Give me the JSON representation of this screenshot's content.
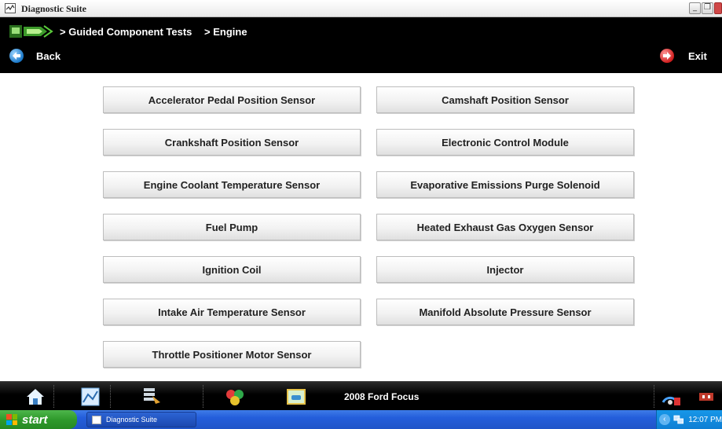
{
  "window": {
    "title": "Diagnostic Suite"
  },
  "header": {
    "breadcrumbs": [
      "> Guided Component Tests",
      "> Engine"
    ],
    "back_label": "Back",
    "exit_label": "Exit"
  },
  "components": {
    "left": [
      "Accelerator Pedal Position Sensor",
      "Crankshaft Position Sensor",
      "Engine Coolant Temperature Sensor",
      "Fuel Pump",
      "Ignition Coil",
      "Intake Air Temperature Sensor",
      "Throttle Positioner Motor Sensor"
    ],
    "right": [
      "Camshaft Position Sensor",
      "Electronic Control Module",
      "Evaporative Emissions Purge Solenoid",
      "Heated Exhaust Gas Oxygen Sensor",
      "Injector",
      "Manifold Absolute Pressure Sensor"
    ]
  },
  "toolbar": {
    "vehicle": "2008 Ford Focus",
    "icons": [
      "home-icon",
      "data-list-icon",
      "tools-icon",
      "modules-icon",
      "vehicle-icon",
      "connection-icon"
    ]
  },
  "taskbar": {
    "start_label": "start",
    "task_label": "Diagnostic Suite",
    "clock": "12:07 PM"
  },
  "colors": {
    "header_bg": "#000000",
    "taskbar_blue": "#245edb",
    "start_green": "#2f9a2c"
  }
}
